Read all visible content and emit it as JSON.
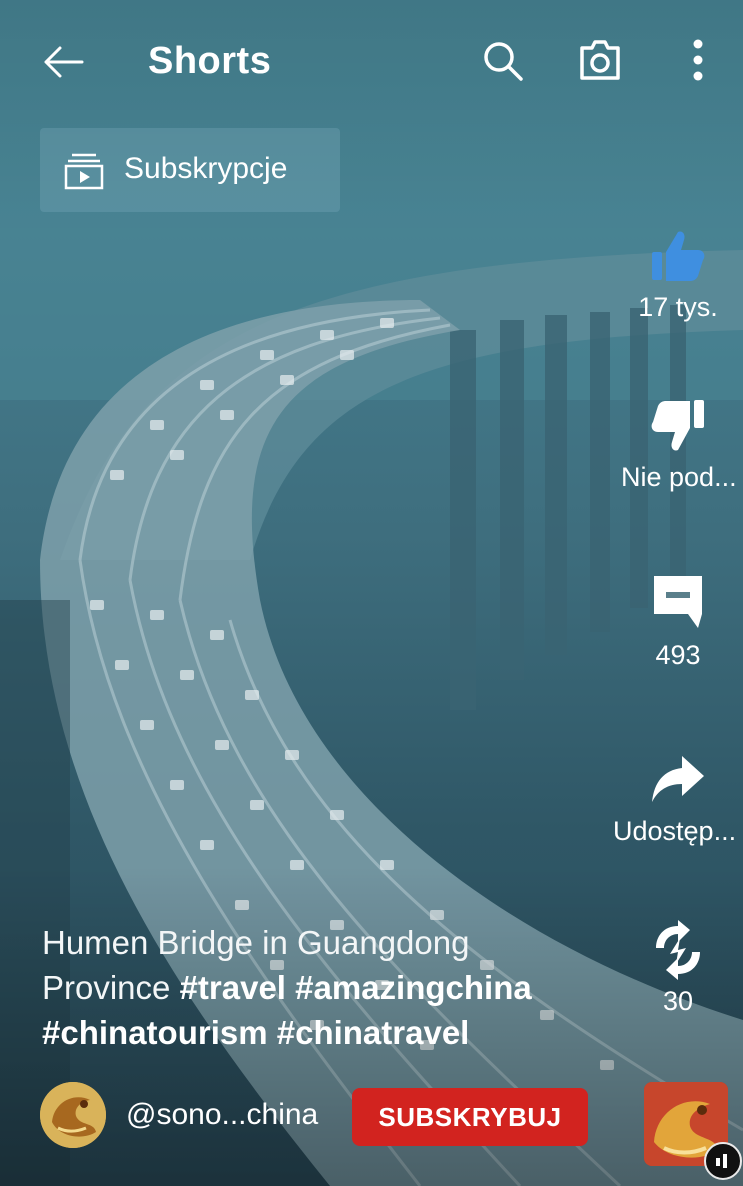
{
  "header": {
    "title": "Shorts"
  },
  "subscriptions_chip": {
    "label": "Subskrypcje"
  },
  "actions": {
    "like_count": "17 tys.",
    "dislike_label": "Nie pod...",
    "comments_count": "493",
    "share_label": "Udostęp...",
    "remix_count": "30"
  },
  "video": {
    "caption_text": "Humen Bridge in Guangdong Province",
    "hashtags": [
      "#travel",
      "#amazingchina",
      "#chinatourism",
      "#chinatravel"
    ]
  },
  "channel": {
    "handle": "@sono...china",
    "subscribe_label": "SUBSKRYBUJ"
  },
  "colors": {
    "accent_like": "#3f8fe0",
    "subscribe_red": "#d2231f"
  },
  "icons": {
    "back": "arrow-left-icon",
    "search": "search-icon",
    "camera": "camera-icon",
    "more": "more-vert-icon",
    "subscriptions": "subscriptions-icon",
    "like": "thumb-up-icon",
    "dislike": "thumb-down-icon",
    "comments": "comment-icon",
    "share": "share-icon",
    "remix": "remix-icon"
  }
}
